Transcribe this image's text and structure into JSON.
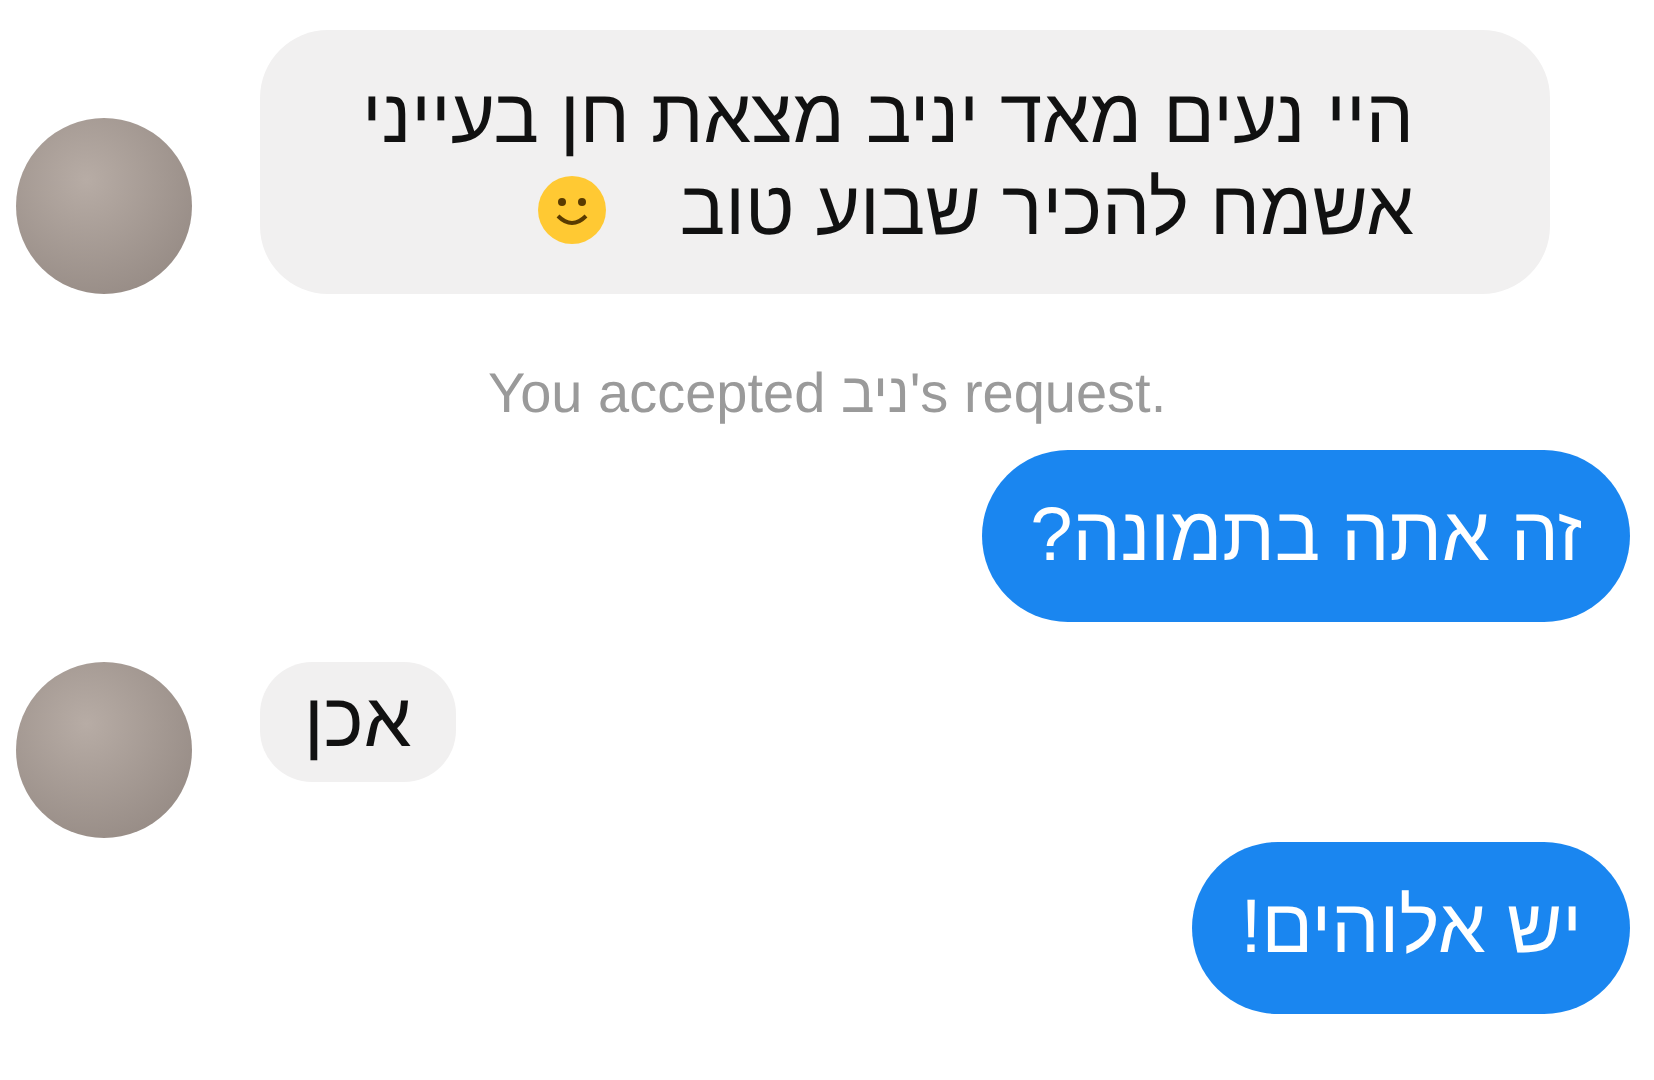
{
  "messages": [
    {
      "kind": "incoming",
      "avatar": true,
      "lines": [
        "היי נעים מאד יניב מצאת חן בעייני",
        "אשמח להכיר שבוע טוב"
      ],
      "trailing_emoji": true
    },
    {
      "kind": "system",
      "text": "You accepted ניב's request."
    },
    {
      "kind": "outgoing",
      "lines": [
        "זה אתה בתמונה?"
      ]
    },
    {
      "kind": "incoming",
      "avatar": true,
      "lines": [
        "אכן"
      ]
    },
    {
      "kind": "outgoing",
      "lines": [
        "יש אלוהים!"
      ]
    }
  ]
}
